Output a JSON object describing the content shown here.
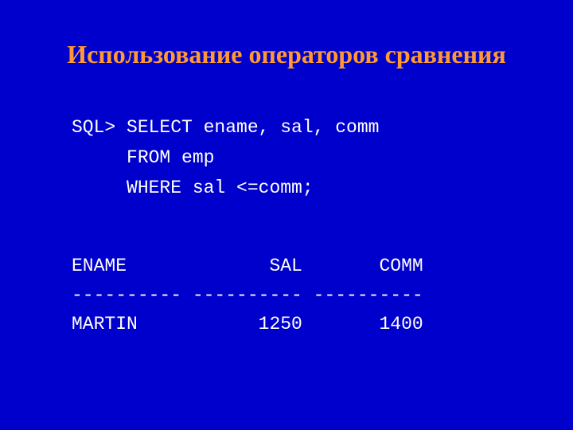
{
  "title": "Использование операторов сравнения",
  "sql": {
    "line1": "SQL> SELECT ename, sal, comm",
    "line2": "     FROM emp",
    "line3": "     WHERE sal <=comm;"
  },
  "output": {
    "header": "ENAME             SAL       COMM",
    "divider": "---------- ---------- ----------",
    "row1": "MARTIN           1250       1400"
  }
}
